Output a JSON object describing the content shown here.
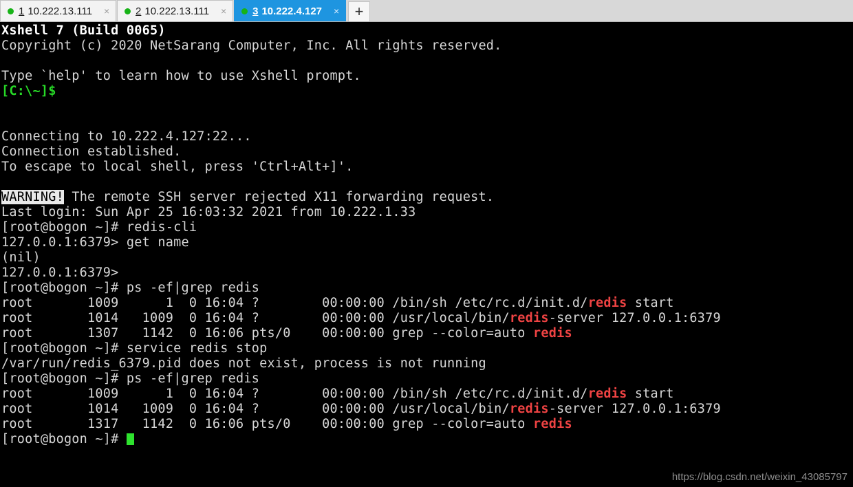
{
  "tabbar": {
    "tabs": [
      {
        "number": "1",
        "label": "10.222.13.111",
        "status_icon": "green-dot-icon",
        "close_icon": "×",
        "active": false
      },
      {
        "number": "2",
        "label": "10.222.13.111",
        "status_icon": "green-dot-icon",
        "close_icon": "×",
        "active": false
      },
      {
        "number": "3",
        "label": "10.222.4.127",
        "status_icon": "green-dot-icon",
        "close_icon": "×",
        "active": true
      }
    ],
    "new_tab_label": "+",
    "active_tab_color": "#1e95e0",
    "status_dot_color": "#17b317"
  },
  "terminal": {
    "colors": {
      "background": "#000000",
      "foreground": "#d7d7d7",
      "green": "#27d927",
      "red": "#ef4343",
      "cursor": "#2ee22e"
    },
    "lines": [
      {
        "t": "Xshell 7 (Build 0065)",
        "c": "bold"
      },
      {
        "t": "Copyright (c) 2020 NetSarang Computer, Inc. All rights reserved.",
        "c": ""
      },
      {
        "t": "",
        "c": ""
      },
      {
        "t": "Type `help' to learn how to use Xshell prompt.",
        "c": ""
      },
      {
        "t": "[C:\\~]$",
        "c": "green"
      },
      {
        "t": "",
        "c": ""
      },
      {
        "t": "",
        "c": ""
      },
      {
        "t": "Connecting to 10.222.4.127:22...",
        "c": ""
      },
      {
        "t": "Connection established.",
        "c": ""
      },
      {
        "t": "To escape to local shell, press 'Ctrl+Alt+]'.",
        "c": ""
      },
      {
        "t": "",
        "c": ""
      },
      {
        "t": "WARNING! The remote SSH server rejected X11 forwarding request.",
        "c": "warn"
      },
      {
        "t": "Last login: Sun Apr 25 16:03:32 2021 from 10.222.1.33",
        "c": ""
      },
      {
        "t": "[root@bogon ~]# redis-cli",
        "c": ""
      },
      {
        "t": "127.0.0.1:6379> get name",
        "c": ""
      },
      {
        "t": "(nil)",
        "c": ""
      },
      {
        "t": "127.0.0.1:6379>",
        "c": ""
      },
      {
        "t": "[root@bogon ~]# ps -ef|grep redis",
        "c": ""
      },
      {
        "t": "root       1009      1  0 16:04 ?        00:00:00 /bin/sh /etc/rc.d/init.d/redis start",
        "c": "ps"
      },
      {
        "t": "root       1014   1009  0 16:04 ?        00:00:00 /usr/local/bin/redis-server 127.0.0.1:6379",
        "c": "ps"
      },
      {
        "t": "root       1307   1142  0 16:06 pts/0    00:00:00 grep --color=auto redis",
        "c": "ps"
      },
      {
        "t": "[root@bogon ~]# service redis stop",
        "c": ""
      },
      {
        "t": "/var/run/redis_6379.pid does not exist, process is not running",
        "c": ""
      },
      {
        "t": "[root@bogon ~]# ps -ef|grep redis",
        "c": ""
      },
      {
        "t": "root       1009      1  0 16:04 ?        00:00:00 /bin/sh /etc/rc.d/init.d/redis start",
        "c": "ps"
      },
      {
        "t": "root       1014   1009  0 16:04 ?        00:00:00 /usr/local/bin/redis-server 127.0.0.1:6379",
        "c": "ps"
      },
      {
        "t": "root       1317   1142  0 16:06 pts/0    00:00:00 grep --color=auto redis",
        "c": "ps"
      },
      {
        "t": "[root@bogon ~]# ",
        "c": "cursor"
      }
    ],
    "highlight_word": "redis",
    "warning_word": "WARNING!"
  },
  "watermark": {
    "text": "https://blog.csdn.net/weixin_43085797"
  }
}
